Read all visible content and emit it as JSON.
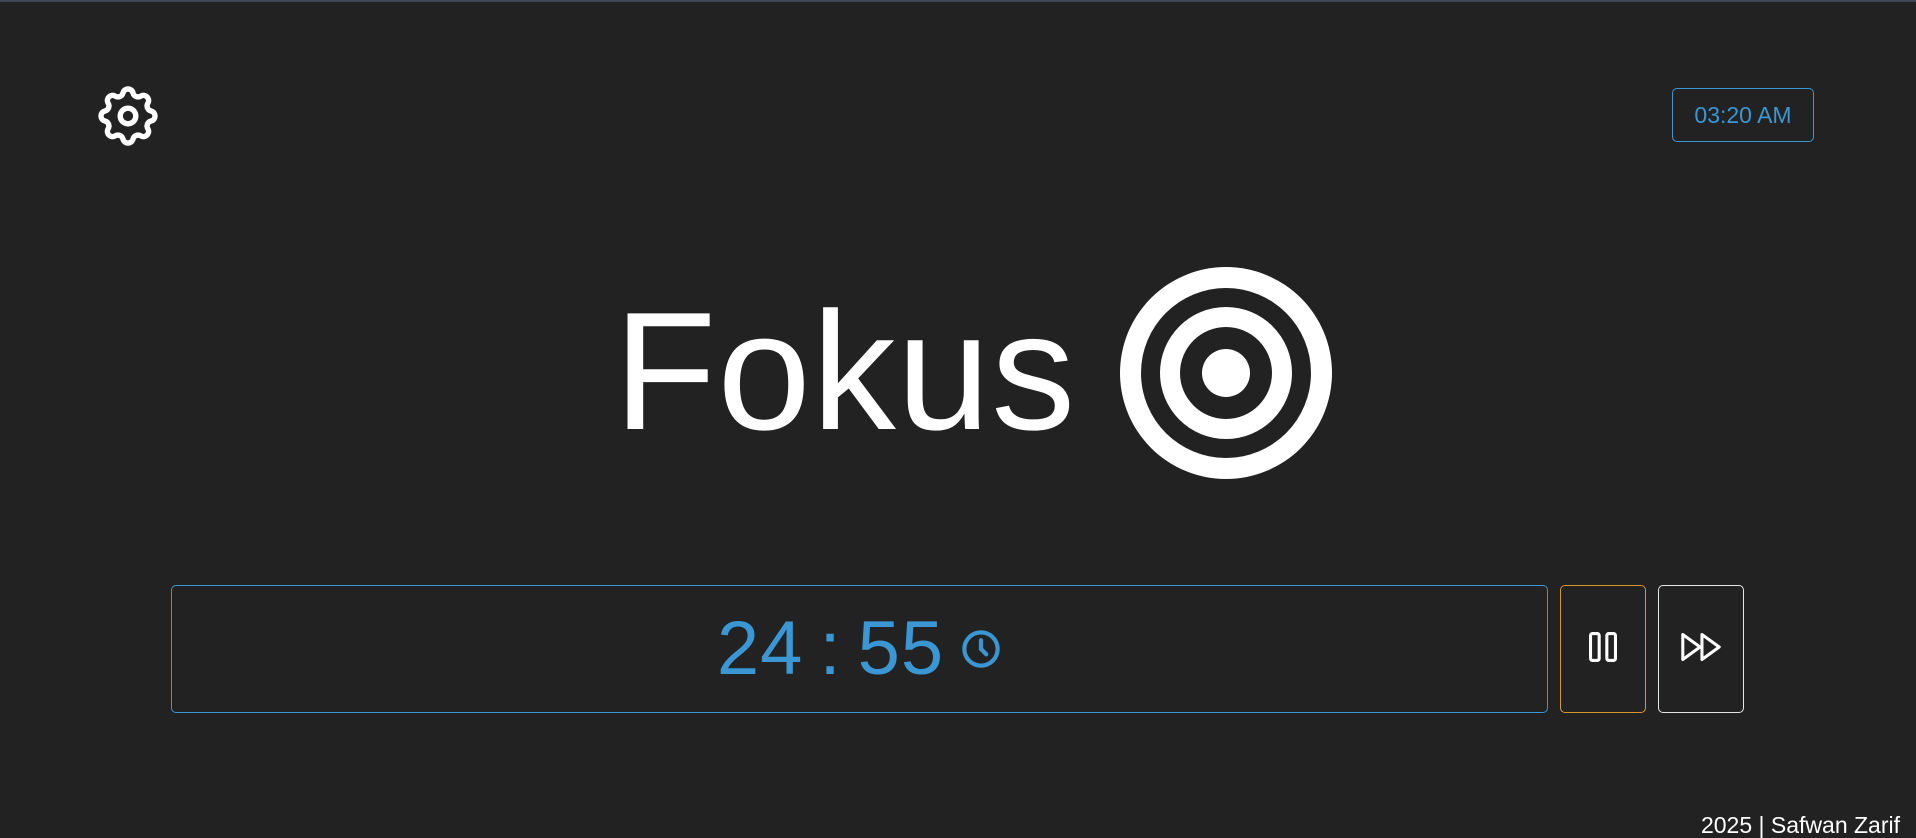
{
  "app": {
    "title": "Fokus",
    "logo_icon": "target-icon"
  },
  "header": {
    "settings_icon": "gear-icon",
    "current_time": "03:20 AM"
  },
  "timer": {
    "minutes": "24",
    "separator": ":",
    "seconds": "55",
    "icon": "clock-icon"
  },
  "controls": {
    "pause_icon": "pause-icon",
    "skip_icon": "fast-forward-icon"
  },
  "footer": {
    "text": "2025 | Safwan Zarif"
  },
  "colors": {
    "background": "#222222",
    "accent": "#3a97d4",
    "pause_border": "#d9962a",
    "text": "#ffffff"
  }
}
